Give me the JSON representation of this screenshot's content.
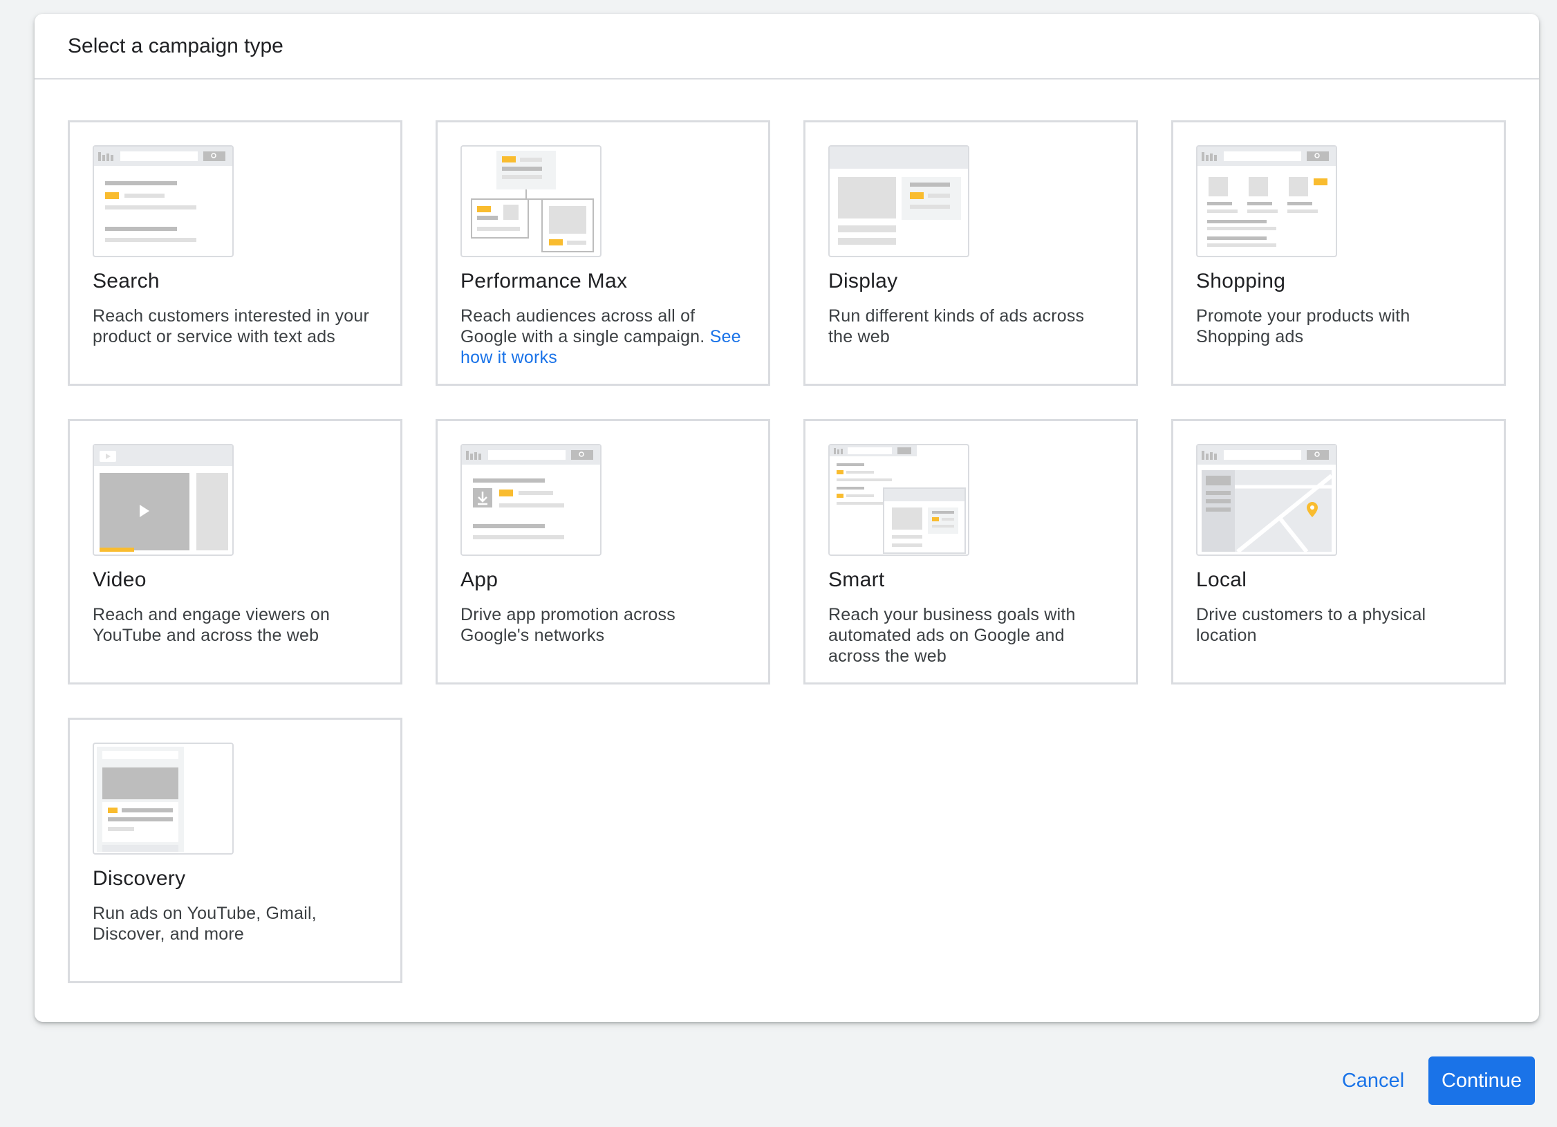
{
  "dialog": {
    "title": "Select a campaign type"
  },
  "cards": [
    {
      "title": "Search",
      "description": "Reach customers interested in your product or service with text ads",
      "illustration": "search-illustration"
    },
    {
      "title": "Performance Max",
      "description": "Reach audiences across all of Google with a single campaign.",
      "link": "See how it works",
      "illustration": "performance-max-illustration"
    },
    {
      "title": "Display",
      "description": "Run different kinds of ads across the web",
      "illustration": "display-illustration"
    },
    {
      "title": "Shopping",
      "description": "Promote your products with Shopping ads",
      "illustration": "shopping-illustration"
    },
    {
      "title": "Video",
      "description": "Reach and engage viewers on YouTube and across the web",
      "illustration": "video-illustration"
    },
    {
      "title": "App",
      "description": "Drive app promotion across Google's networks",
      "illustration": "app-illustration"
    },
    {
      "title": "Smart",
      "description": "Reach your business goals with automated ads on Google and across the web",
      "illustration": "smart-illustration"
    },
    {
      "title": "Local",
      "description": "Drive customers to a physical location",
      "illustration": "local-illustration"
    },
    {
      "title": "Discovery",
      "description": "Run ads on YouTube, Gmail, Discover, and more",
      "illustration": "discovery-illustration"
    }
  ],
  "footer": {
    "cancel_label": "Cancel",
    "continue_label": "Continue"
  },
  "colors": {
    "accent": "#1a73e8",
    "highlight": "#f9bc2f",
    "border": "#dadce0",
    "placeholder": "#e0e0e0"
  }
}
